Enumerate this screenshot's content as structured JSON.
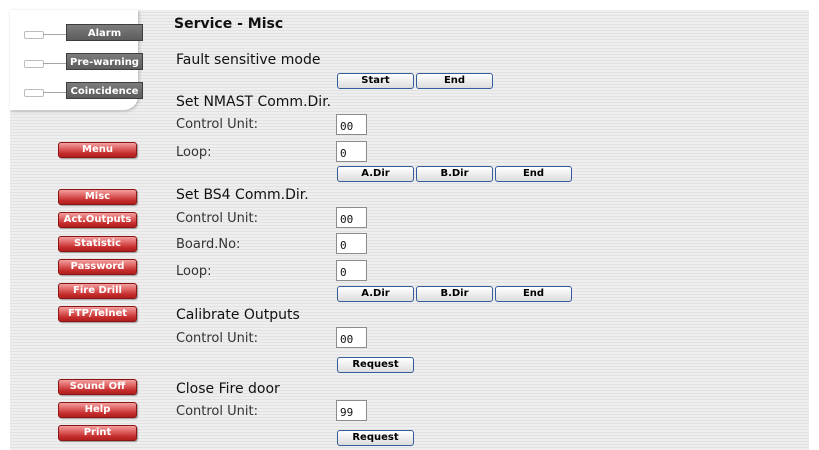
{
  "status": {
    "items": [
      {
        "label": "Alarm"
      },
      {
        "label": "Pre-warning"
      },
      {
        "label": "Coincidence"
      }
    ]
  },
  "nav": {
    "menu": "Menu",
    "items": [
      {
        "label": "Misc"
      },
      {
        "label": "Act.Outputs"
      },
      {
        "label": "Statistic"
      },
      {
        "label": "Password"
      },
      {
        "label": "Fire Drill"
      },
      {
        "label": "FTP/Telnet"
      }
    ],
    "sound_off": "Sound Off",
    "help": "Help",
    "print": "Print"
  },
  "page": {
    "title": "Service - Misc"
  },
  "fault_mode": {
    "title": "Fault sensitive mode",
    "start": "Start",
    "end": "End"
  },
  "nmast": {
    "title": "Set NMAST Comm.Dir.",
    "control_unit_label": "Control Unit:",
    "control_unit_value": "00",
    "loop_label": "Loop:",
    "loop_value": "0",
    "adir": "A.Dir",
    "bdir": "B.Dir",
    "end": "End"
  },
  "bs4": {
    "title": "Set BS4 Comm.Dir.",
    "control_unit_label": "Control Unit:",
    "control_unit_value": "00",
    "board_label": "Board.No:",
    "board_value": "0",
    "loop_label": "Loop:",
    "loop_value": "0",
    "adir": "A.Dir",
    "bdir": "B.Dir",
    "end": "End"
  },
  "calibrate": {
    "title": "Calibrate Outputs",
    "control_unit_label": "Control Unit:",
    "control_unit_value": "00",
    "request": "Request"
  },
  "fire_door": {
    "title": "Close Fire door",
    "control_unit_label": "Control Unit:",
    "control_unit_value": "99",
    "request": "Request"
  }
}
